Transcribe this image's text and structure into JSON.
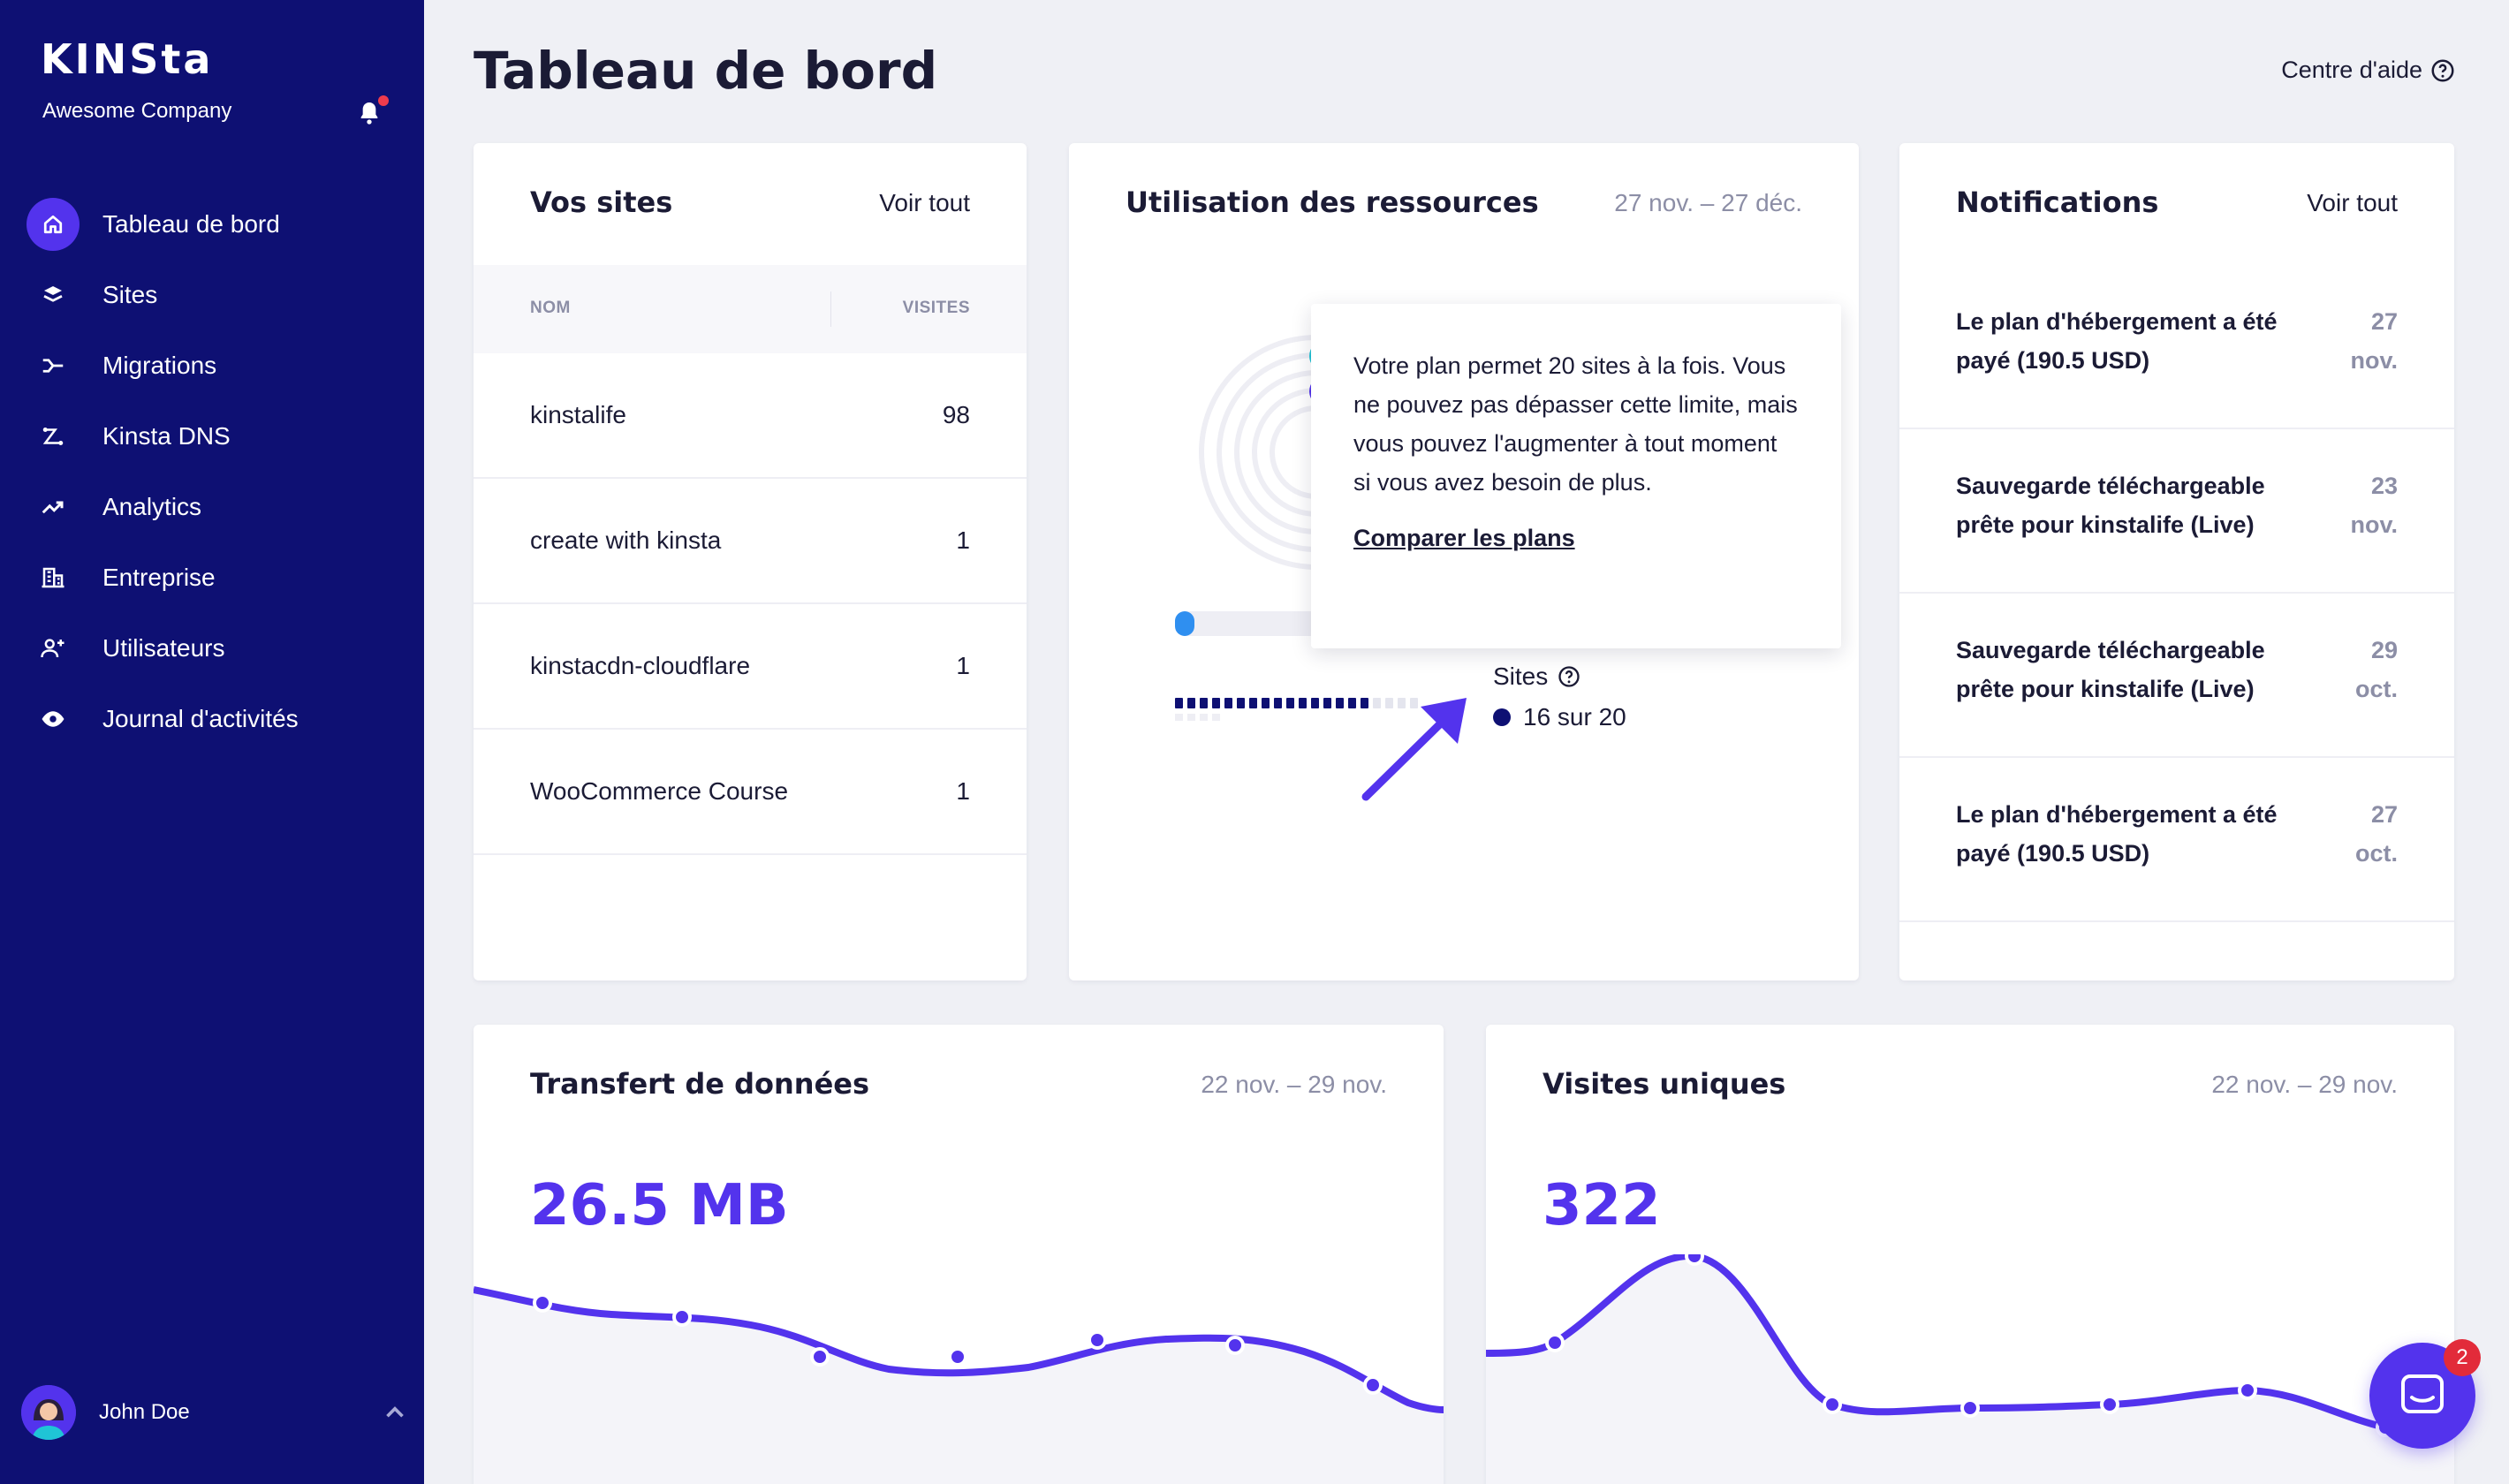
{
  "brand": {
    "logo": "KINSta",
    "company": "Awesome Company"
  },
  "sidebar": {
    "items": [
      {
        "label": "Tableau de bord",
        "icon": "home-icon",
        "active": true
      },
      {
        "label": "Sites",
        "icon": "layers-icon"
      },
      {
        "label": "Migrations",
        "icon": "migrations-icon"
      },
      {
        "label": "Kinsta DNS",
        "icon": "dns-icon"
      },
      {
        "label": "Analytics",
        "icon": "analytics-icon"
      },
      {
        "label": "Entreprise",
        "icon": "building-icon"
      },
      {
        "label": "Utilisateurs",
        "icon": "add-user-icon"
      },
      {
        "label": "Journal d'activités",
        "icon": "eye-icon"
      }
    ]
  },
  "user": {
    "name": "John Doe"
  },
  "header": {
    "title": "Tableau de bord",
    "help": "Centre d'aide"
  },
  "sites_card": {
    "title": "Vos sites",
    "link": "Voir tout",
    "columns": [
      "NOM",
      "VISITES"
    ],
    "rows": [
      {
        "name": "kinstalife",
        "visits": "98"
      },
      {
        "name": "create with kinsta",
        "visits": "1"
      },
      {
        "name": "kinstacdn-cloudflare",
        "visits": "1"
      },
      {
        "name": "WooCommerce Course",
        "visits": "1"
      }
    ]
  },
  "resources_card": {
    "title": "Utilisation des ressources",
    "date_range": "27 nov. – 27 déc.",
    "tooltip": {
      "text": "Votre plan permet 20 sites à la fois. Vous ne pouvez pas dépasser cette limite, mais vous pouvez l'augmenter à tout moment si vous avez besoin de plus.",
      "link": "Comparer les plans"
    },
    "legend": {
      "label": "Sites",
      "value": "16 sur 20"
    },
    "sites_used": 16,
    "sites_limit": 20
  },
  "notifications_card": {
    "title": "Notifications",
    "link": "Voir tout",
    "items": [
      {
        "text": "Le plan d'hébergement a été payé (190.5 USD)",
        "day": "27",
        "month": "nov."
      },
      {
        "text": "Sauvegarde téléchargeable prête pour kinstalife (Live)",
        "day": "23",
        "month": "nov."
      },
      {
        "text": "Sauvegarde téléchargeable prête pour kinstalife (Live)",
        "day": "29",
        "month": "oct."
      },
      {
        "text": "Le plan d'hébergement a été payé (190.5 USD)",
        "day": "27",
        "month": "oct."
      }
    ]
  },
  "transfer_card": {
    "title": "Transfert de données",
    "date_range": "22 nov. – 29 nov.",
    "value": "26.5 MB"
  },
  "visits_card": {
    "title": "Visites uniques",
    "date_range": "22 nov. – 29 nov.",
    "value": "322"
  },
  "chat": {
    "badge": "2"
  },
  "colors": {
    "sidebar": "#0e1073",
    "accent": "#5333ed",
    "badge": "#e22b3a",
    "teal": "#1fc4d6"
  }
}
